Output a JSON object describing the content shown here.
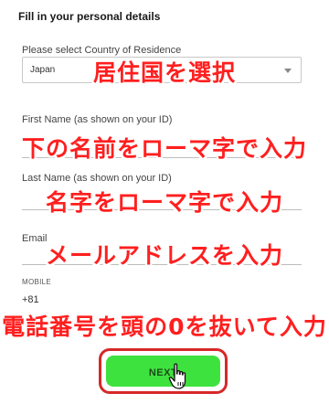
{
  "form": {
    "title": "Fill in your personal details",
    "country": {
      "label": "Please select Country of Residence",
      "value": "Japan"
    },
    "first_name": {
      "label": "First Name (as shown on your ID)",
      "value": ""
    },
    "last_name": {
      "label": "Last Name (as shown on your ID)",
      "value": ""
    },
    "email": {
      "label": "Email",
      "value": ""
    },
    "mobile": {
      "label": "MOBILE",
      "country_code": "+81",
      "value": ""
    },
    "next_button": {
      "label": "NEXT"
    }
  },
  "annotations": {
    "country_note": "居住国を選択",
    "first_name_note": "下の名前をローマ字で入力",
    "last_name_note": "名字をローマ字で入力",
    "email_note": "メールアドレスを入力",
    "mobile_note": "電話番号を頭の0を抜いて入力"
  },
  "icons": {
    "select_arrow": "chevron-down-icon",
    "cursor": "hand-pointer-icon"
  },
  "colors": {
    "annotation_text": "#ff1f1f",
    "next_button_bg": "#3ee23e",
    "highlight_frame": "#d62828"
  }
}
